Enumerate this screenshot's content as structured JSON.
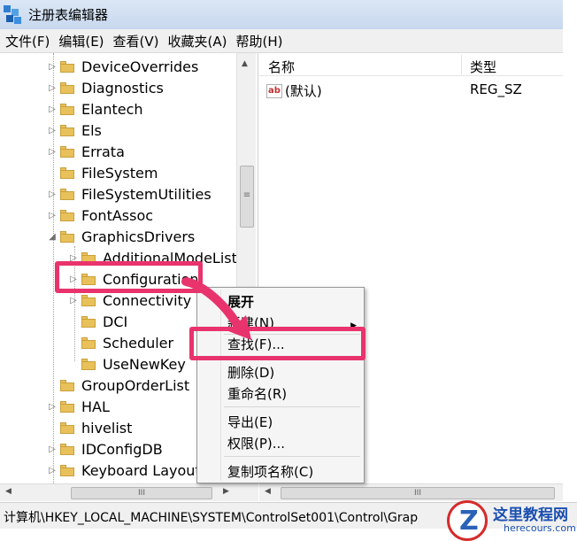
{
  "window": {
    "title": "注册表编辑器"
  },
  "menu": [
    "文件(F)",
    "编辑(E)",
    "查看(V)",
    "收藏夹(A)",
    "帮助(H)"
  ],
  "tree": {
    "items": [
      {
        "label": "DeviceOverrides",
        "expander": "▷"
      },
      {
        "label": "Diagnostics",
        "expander": "▷"
      },
      {
        "label": "Elantech",
        "expander": "▷"
      },
      {
        "label": "Els",
        "expander": "▷"
      },
      {
        "label": "Errata",
        "expander": "▷"
      },
      {
        "label": "FileSystem",
        "expander": ""
      },
      {
        "label": "FileSystemUtilities",
        "expander": "▷"
      },
      {
        "label": "FontAssoc",
        "expander": "▷"
      },
      {
        "label": "GraphicsDrivers",
        "expander": "◢"
      },
      {
        "label": "AdditionalModeLists",
        "expander": "▷"
      },
      {
        "label": "Configuration",
        "expander": "▷"
      },
      {
        "label": "Connectivity",
        "expander": "▷"
      },
      {
        "label": "DCI",
        "expander": ""
      },
      {
        "label": "Scheduler",
        "expander": ""
      },
      {
        "label": "UseNewKey",
        "expander": ""
      },
      {
        "label": "GroupOrderList",
        "expander": ""
      },
      {
        "label": "HAL",
        "expander": "▷"
      },
      {
        "label": "hivelist",
        "expander": ""
      },
      {
        "label": "IDConfigDB",
        "expander": "▷"
      },
      {
        "label": "Keyboard Layout",
        "expander": "▷"
      }
    ]
  },
  "list": {
    "columns": {
      "name": "名称",
      "type": "类型"
    },
    "rows": [
      {
        "name": "(默认)",
        "type": "REG_SZ",
        "icon": "ab"
      }
    ]
  },
  "context_menu": {
    "expand": "展开",
    "new": "新建(N)",
    "find": "查找(F)...",
    "delete": "删除(D)",
    "rename": "重命名(R)",
    "export": "导出(E)",
    "permissions": "权限(P)...",
    "copy_key_name": "复制项名称(C)"
  },
  "statusbar": {
    "path": "计算机\\HKEY_LOCAL_MACHINE\\SYSTEM\\ControlSet001\\Control\\Grap"
  },
  "scroll": {
    "thumb_glyph": "III",
    "vthumb_glyph": "≡"
  },
  "watermark": {
    "title": "这里教程网",
    "subtitle": "herecours.com",
    "logo_letter": "Z"
  },
  "colors": {
    "highlight": "#e8336c",
    "folder": "#e8c15a",
    "title_gradient_top": "#dbe7f5"
  }
}
